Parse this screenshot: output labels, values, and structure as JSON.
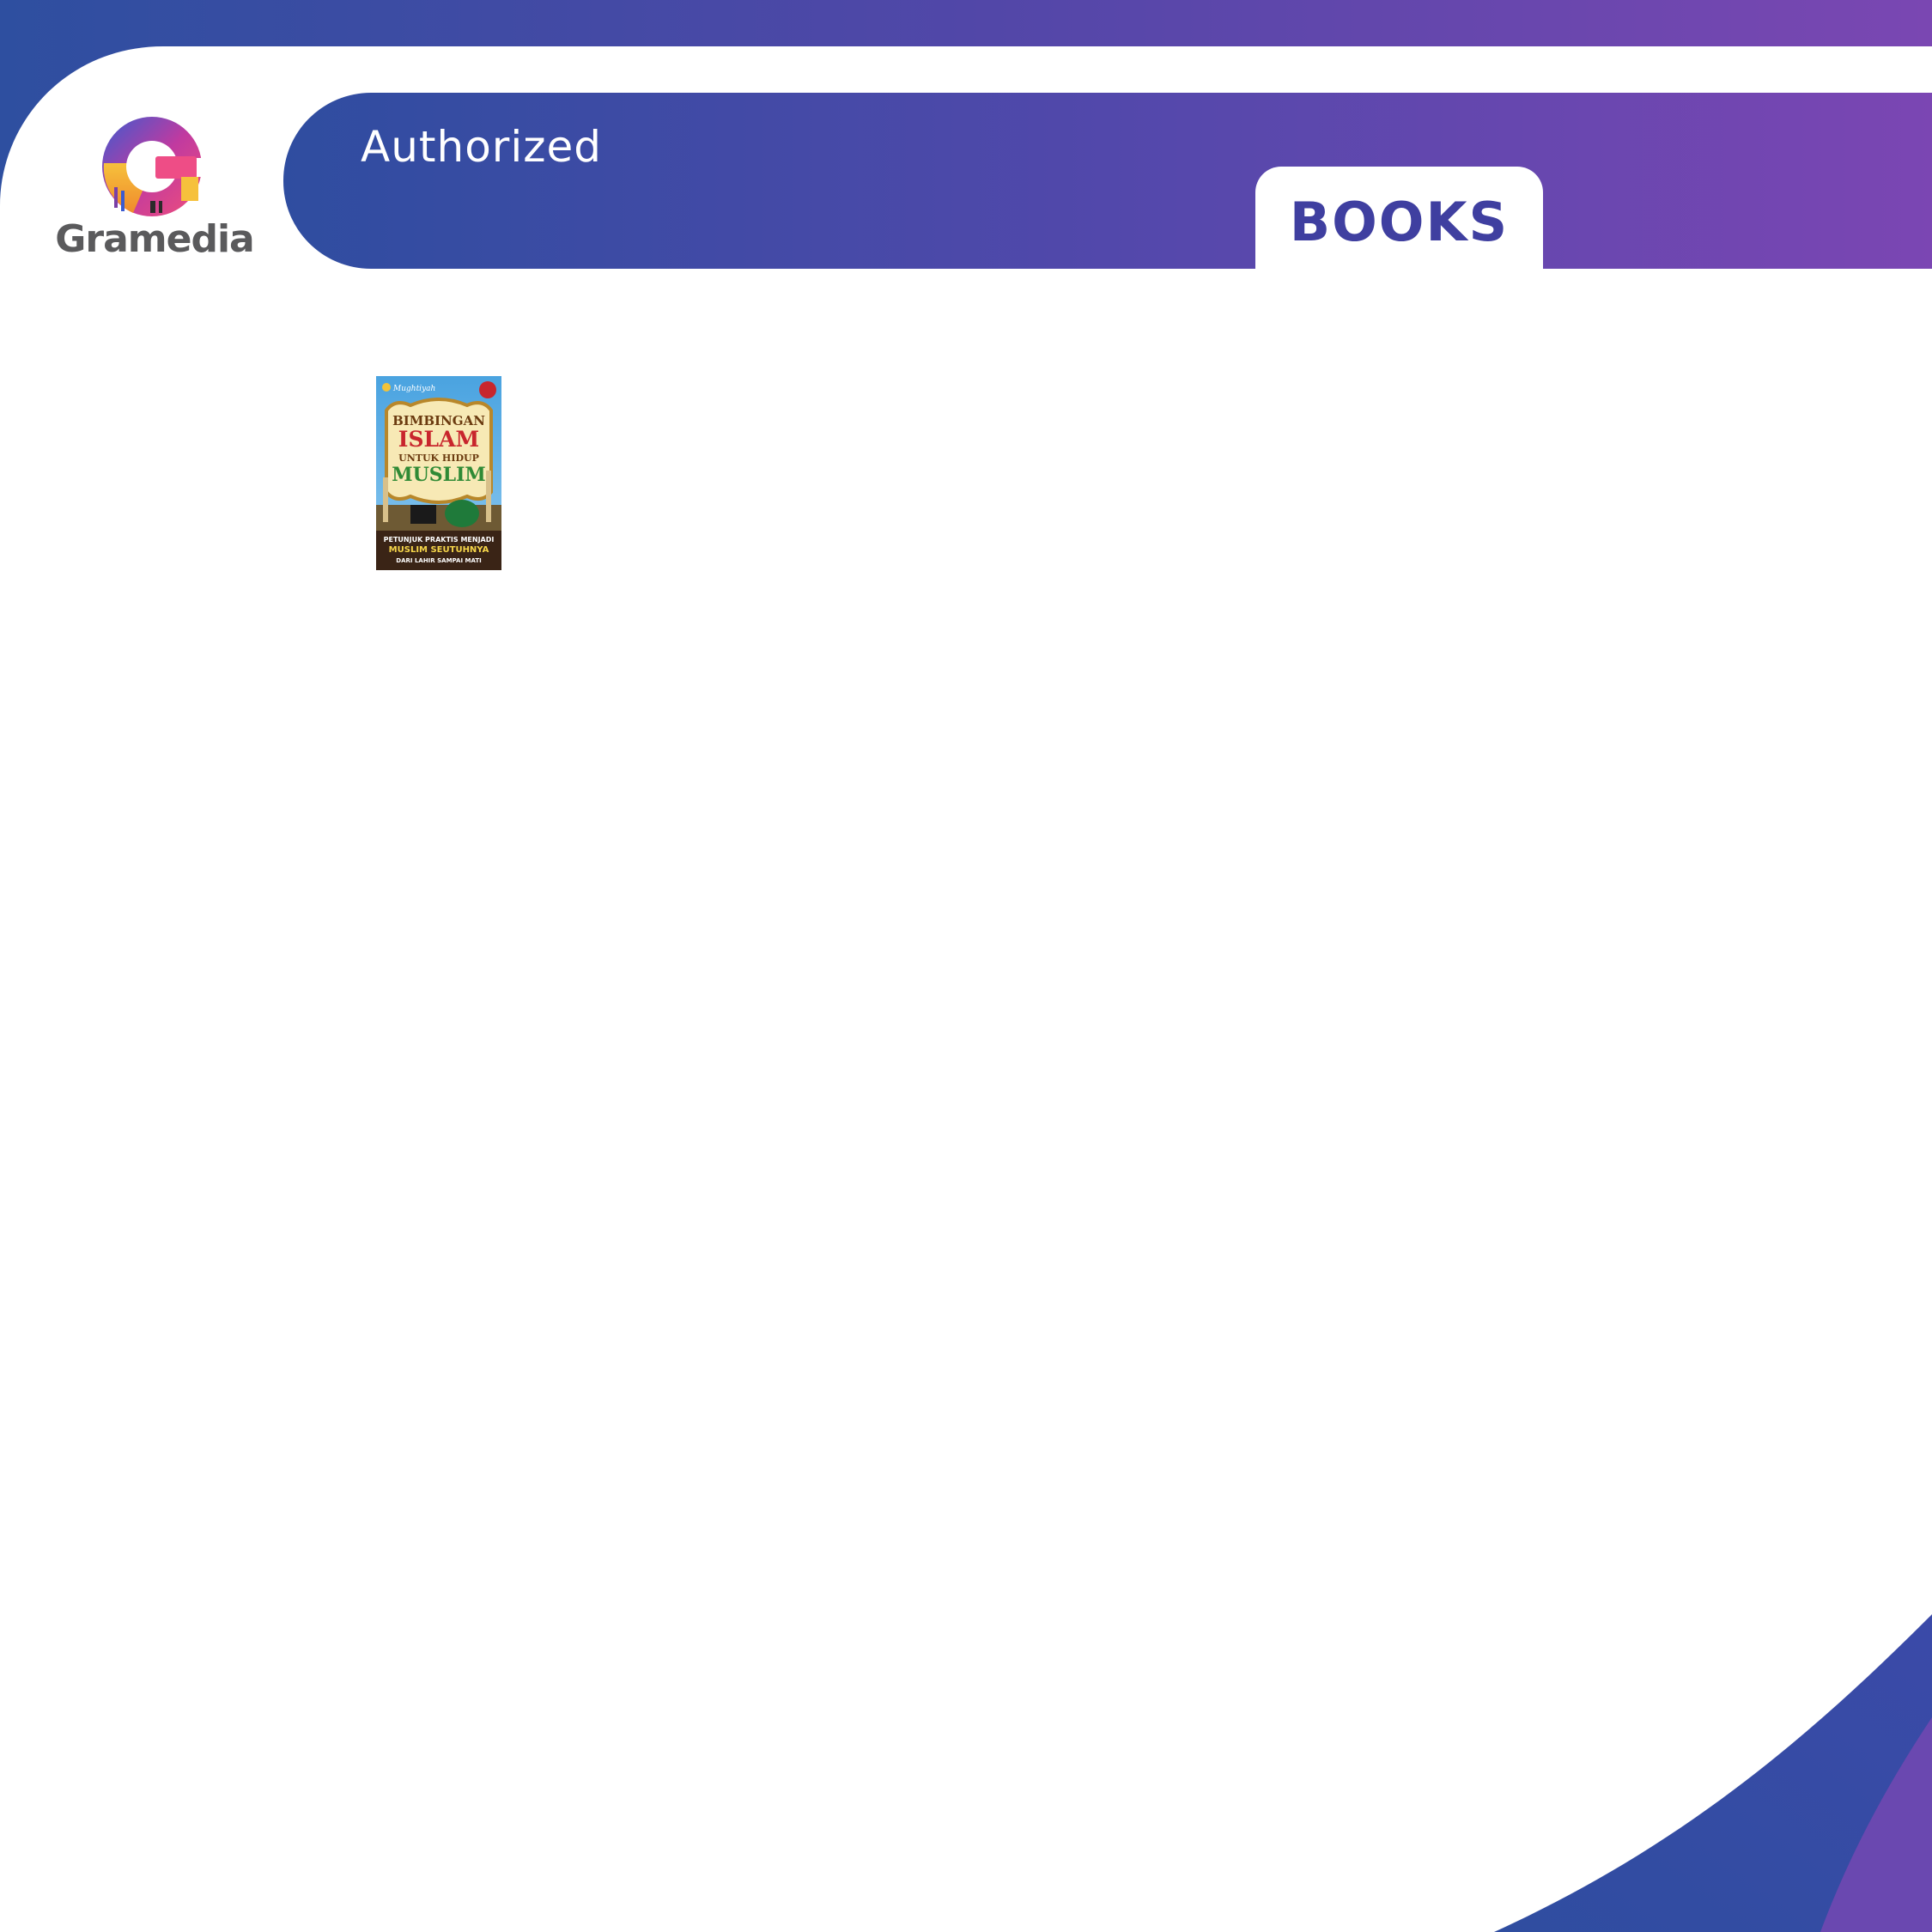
{
  "brand": {
    "name": "Gramedia",
    "gradient_start": "#2e4fa0",
    "gradient_end": "#7a47b2"
  },
  "banner": {
    "label": "Authorized",
    "tab_label": "BOOKS"
  },
  "product": {
    "cover": {
      "publisher_mark": "Mughtiyah",
      "title_line_1": "BIMBINGAN",
      "title_line_2": "ISLAM",
      "title_line_3": "UNTUK HIDUP",
      "title_line_4": "MUSLIM",
      "subtitle_line_1": "PETUNJUK PRAKTIS MENJADI",
      "subtitle_line_2": "MUSLIM SEUTUHNYA",
      "subtitle_line_3": "DARI LAHIR SAMPAI MATI"
    }
  }
}
